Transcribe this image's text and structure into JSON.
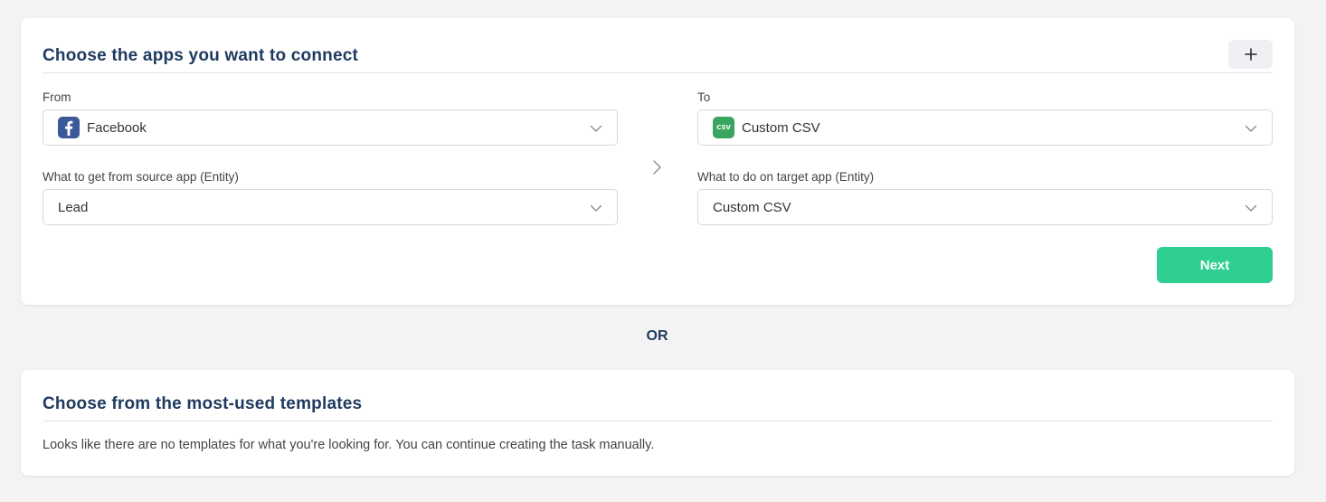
{
  "connect": {
    "title": "Choose the apps you want to connect",
    "add_icon": "plus-icon",
    "from": {
      "label": "From",
      "app": "Facebook",
      "app_icon": "facebook-icon",
      "entity_label": "What to get from source app (Entity)",
      "entity": "Lead"
    },
    "to": {
      "label": "To",
      "app": "Custom CSV",
      "app_icon": "csv-icon",
      "app_icon_text": "CSV",
      "entity_label": "What to do on target app (Entity)",
      "entity": "Custom CSV"
    },
    "next_label": "Next"
  },
  "separator": "OR",
  "templates": {
    "title": "Choose from the most-used templates",
    "empty_message": "Looks like there are no templates for what you're looking for. You can continue creating the task manually."
  },
  "colors": {
    "accent": "#2fcf91",
    "heading": "#1e3a5f",
    "facebook": "#3b5998",
    "csv": "#3aa55f"
  }
}
